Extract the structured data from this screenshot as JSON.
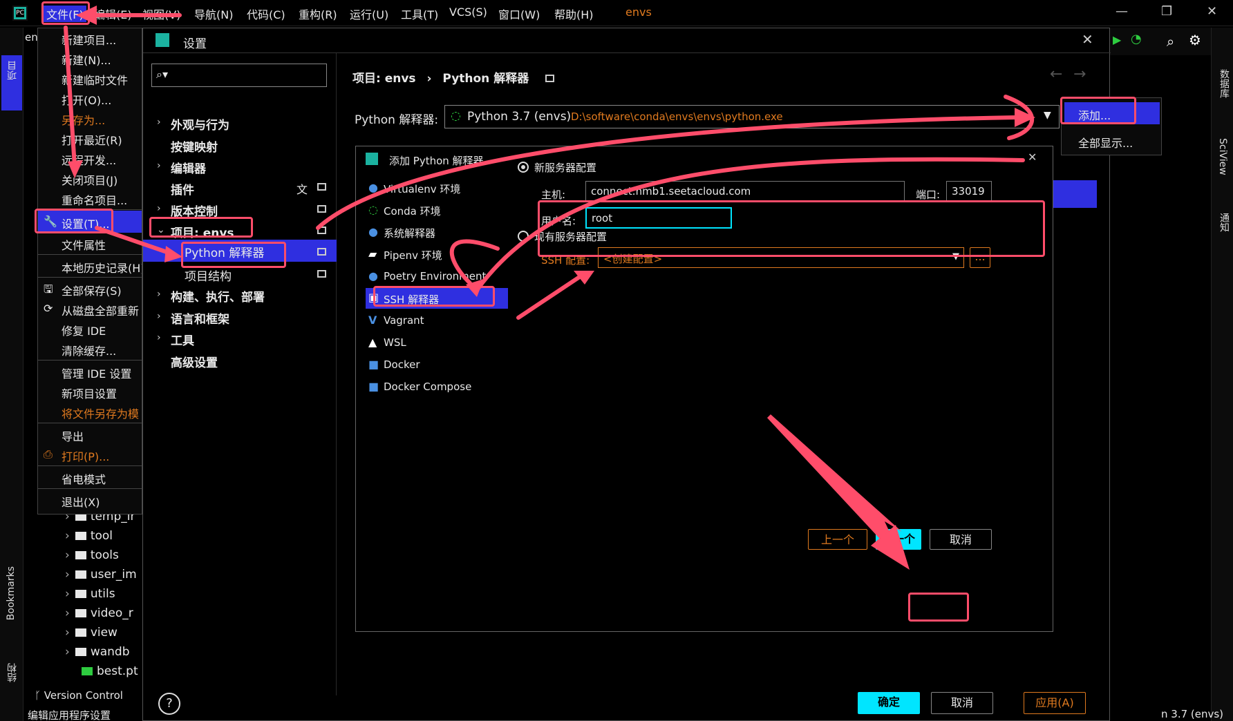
{
  "menubar": {
    "items": [
      "文件(F)",
      "编辑(E)",
      "视图(V)",
      "导航(N)",
      "代码(C)",
      "重构(R)",
      "运行(U)",
      "工具(T)",
      "VCS(S)",
      "窗口(W)",
      "帮助(H)"
    ],
    "project_name": "envs",
    "min": "—",
    "restore": "❐",
    "close": "✕"
  },
  "left_strip": {
    "project": "项目",
    "bookmarks": "Bookmarks",
    "structure": "结构"
  },
  "right_strip": {
    "database": "数据库",
    "sciview": "SciView",
    "notifications": "通知"
  },
  "tree": {
    "rows": [
      "temp_ir",
      "tool",
      "tools",
      "user_im",
      "utils",
      "video_r",
      "view",
      "wandb",
      "best.pt"
    ],
    "version_control": "Version Control",
    "status": "编辑应用程序设置",
    "status_right": "n 3.7 (envs)",
    "tab_label": "en"
  },
  "file_menu": {
    "items": [
      "新建项目...",
      "新建(N)...",
      "新建临时文件",
      "打开(O)...",
      "另存为...",
      "打开最近(R)",
      "远程开发...",
      "关闭项目(J)",
      "重命名项目...",
      "设置(T)...",
      "文件属性",
      "本地历史记录(H)",
      "全部保存(S)",
      "从磁盘全部重新",
      "修复 IDE",
      "清除缓存...",
      "管理 IDE 设置",
      "新项目设置",
      "将文件另存为模",
      "导出",
      "打印(P)...",
      "省电模式",
      "退出(X)"
    ]
  },
  "settings": {
    "title": "设置",
    "search_placeholder": "",
    "breadcrumb_project": "项目: envs",
    "breadcrumb_sep": "›",
    "breadcrumb_page": "Python 解释器",
    "side": [
      "外观与行为",
      "按键映射",
      "编辑器",
      "插件",
      "版本控制",
      "项目: envs",
      "Python 解释器",
      "项目结构",
      "构建、执行、部署",
      "语言和框架",
      "工具",
      "高级设置"
    ],
    "interpreter_label": "Python 解释器:",
    "interpreter_value": "Python 3.7 (envs)",
    "interpreter_path": "D:\\software\\conda\\envs\\envs\\python.exe",
    "add_menu": [
      "添加...",
      "全部显示..."
    ],
    "ok": "确定",
    "cancel": "取消",
    "apply": "应用(A)",
    "help": "?"
  },
  "add_dialog": {
    "title": "添加 Python 解释器",
    "envs": [
      "Virtualenv 环境",
      "Conda 环境",
      "系统解释器",
      "Pipenv 环境",
      "Poetry Environment",
      "SSH 解释器",
      "Vagrant",
      "WSL",
      "Docker",
      "Docker Compose"
    ],
    "new_server": "新服务器配置",
    "host_label": "主机:",
    "host_value": "connect.nmb1.seetacloud.com",
    "port_label": "端口:",
    "port_value": "33019",
    "user_label": "用户名:",
    "user_value": "root",
    "existing_server": "现有服务器配置",
    "ssh_config_label": "SSH 配置:",
    "ssh_config_value": "<创建配置>",
    "more": "...",
    "prev": "上一个",
    "next": "下一个",
    "cancel": "取消"
  },
  "colors": {
    "accent_blue": "#2f2fe0",
    "highlight_cyan": "#00e5ff",
    "annotation_red": "#ff4d6a",
    "warning_orange": "#e07a1f"
  }
}
